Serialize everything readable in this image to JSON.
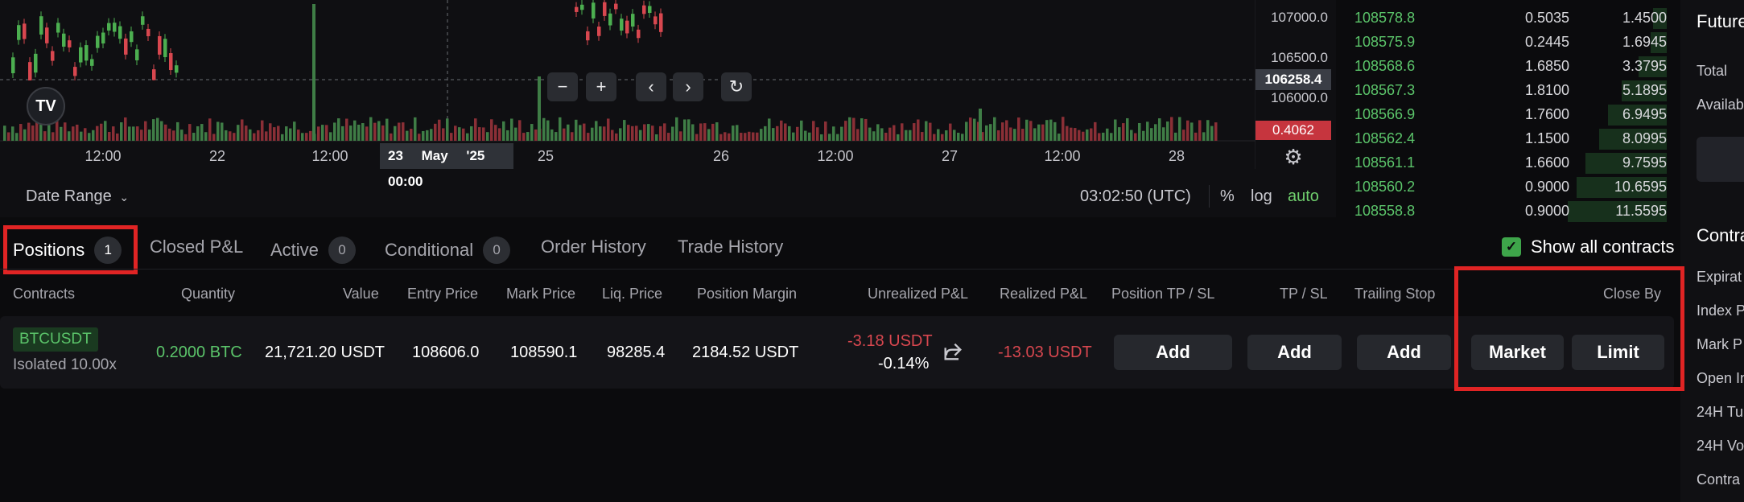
{
  "chart": {
    "price_labels": [
      "107000.0",
      "106500.0",
      "106000.0"
    ],
    "current_price": "106258.4",
    "volume_value": "0.4062",
    "time_labels": [
      "12:00",
      "22",
      "12:00",
      "25",
      "26",
      "12:00",
      "27",
      "12:00",
      "28"
    ],
    "crosshair_time": "23 May '25 00:00",
    "tradingview_logo": "TV",
    "zoom_out_icon": "minus-icon",
    "zoom_in_icon": "plus-icon",
    "scroll_left_icon": "chevron-left-icon",
    "scroll_right_icon": "chevron-right-icon",
    "reset_icon": "reset-icon",
    "date_range_label": "Date Range",
    "clock": "03:02:50 (UTC)",
    "scale_percent": "%",
    "scale_log": "log",
    "scale_auto": "auto"
  },
  "orderbook": {
    "rows": [
      {
        "price": "108578.8",
        "qty": "0.5035",
        "total": "1.4500",
        "depth": 0.12
      },
      {
        "price": "108575.9",
        "qty": "0.2445",
        "total": "1.6945",
        "depth": 0.14
      },
      {
        "price": "108568.6",
        "qty": "1.6850",
        "total": "3.3795",
        "depth": 0.25
      },
      {
        "price": "108567.3",
        "qty": "1.8100",
        "total": "5.1895",
        "depth": 0.4
      },
      {
        "price": "108566.9",
        "qty": "1.7600",
        "total": "6.9495",
        "depth": 0.52
      },
      {
        "price": "108562.4",
        "qty": "1.1500",
        "total": "8.0995",
        "depth": 0.6
      },
      {
        "price": "108561.1",
        "qty": "1.6600",
        "total": "9.7595",
        "depth": 0.72
      },
      {
        "price": "108560.2",
        "qty": "0.9000",
        "total": "10.6595",
        "depth": 0.8
      },
      {
        "price": "108558.8",
        "qty": "0.9000",
        "total": "11.5595",
        "depth": 0.88
      }
    ]
  },
  "sidepanel": {
    "title": "Future",
    "total": "Total",
    "available": "Availab",
    "contract_title": "Contra",
    "items": [
      "Expirat",
      "Index P",
      "Mark P",
      "Open In",
      "24H Tu",
      "24H Vo",
      "Contra"
    ]
  },
  "tabs": [
    {
      "label": "Positions",
      "badge": "1"
    },
    {
      "label": "Closed P&L",
      "badge": ""
    },
    {
      "label": "Active",
      "badge": "0"
    },
    {
      "label": "Conditional",
      "badge": "0"
    },
    {
      "label": "Order History",
      "badge": ""
    },
    {
      "label": "Trade History",
      "badge": ""
    }
  ],
  "show_all_contracts": "Show all contracts",
  "table": {
    "headers": {
      "contracts": "Contracts",
      "quantity": "Quantity",
      "value": "Value",
      "entry_price": "Entry Price",
      "mark_price": "Mark Price",
      "liq_price": "Liq. Price",
      "position_margin": "Position Margin",
      "unrealized": "Unrealized P&L",
      "realized": "Realized P&L",
      "position_tpsl": "Position TP / SL",
      "tpsl": "TP / SL",
      "trailing_stop": "Trailing Stop",
      "close_by": "Close By"
    },
    "row": {
      "symbol": "BTCUSDT",
      "margin_mode": "Isolated 10.00x",
      "quantity": "0.2000 BTC",
      "value": "21,721.20 USDT",
      "entry_price": "108606.0",
      "mark_price": "108590.1",
      "liq_price": "98285.4",
      "position_margin": "2184.52 USDT",
      "unrealized_pnl": "-3.18 USDT",
      "unrealized_pct": "-0.14%",
      "realized_pnl": "-13.03 USDT",
      "position_tpsl_btn": "Add",
      "tpsl_btn": "Add",
      "trailing_btn": "Add",
      "market_btn": "Market",
      "limit_btn": "Limit"
    }
  },
  "colors": {
    "green": "#5bc46a",
    "red": "#d8474f",
    "highlight": "#e02424"
  }
}
